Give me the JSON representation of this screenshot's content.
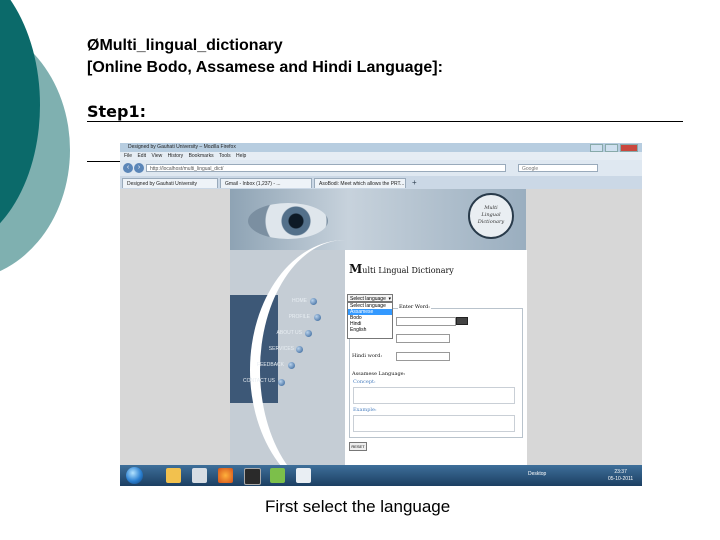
{
  "slide": {
    "title_line1": "Multi_lingual_dictionary",
    "title_bullet": "Ø",
    "title_line2": "[Online  Bodo, Assamese and Hindi Language]:",
    "step_label": "Step1:",
    "caption": "First select the language"
  },
  "browser": {
    "window_title": "Designed by Gauhati University – Mozilla Firefox",
    "menu": [
      "File",
      "Edit",
      "View",
      "History",
      "Bookmarks",
      "Tools",
      "Help"
    ],
    "url": "http://localhost/multi_lingual_dict/",
    "search_placeholder": "Google",
    "tabs": [
      {
        "label": "Designed by Gauhati University"
      },
      {
        "label": "Gmail - Inbox (1,237) - ..."
      },
      {
        "label": "AsoBodi: Meet which allows the PRT..."
      }
    ],
    "new_tab": "+"
  },
  "page": {
    "logo_text": [
      "Multi",
      "Lingual",
      "Dictionary"
    ],
    "nav": [
      "HOME",
      "PROFILE",
      "ABOUT US",
      "SERVICES",
      "FEEDBACK",
      "CONTACT US"
    ],
    "dict_title_big": "M",
    "dict_title_rest": "ulti Lingual Dictionary",
    "select_value": "Select language",
    "select_options": [
      "Select language",
      "Assamese",
      "Bodo",
      "Hindi",
      "English"
    ],
    "enter_word_label": "Enter Word:",
    "bodo_label": "Bodo word:",
    "hindi_label": "Hindi word:",
    "assamese_heading": "Assamese Language:",
    "concept_label": "Concept:",
    "example_label": "Example:",
    "reset_label": "RESET"
  },
  "taskbar": {
    "tray_text": "Desktop",
    "time": "23:37",
    "date": "05-10-2011"
  },
  "colors": {
    "deco_dark": "#0b6a6a",
    "deco_light": "#7fb0b0",
    "nav_block": "#3d5877",
    "highlight": "#3399ff"
  }
}
